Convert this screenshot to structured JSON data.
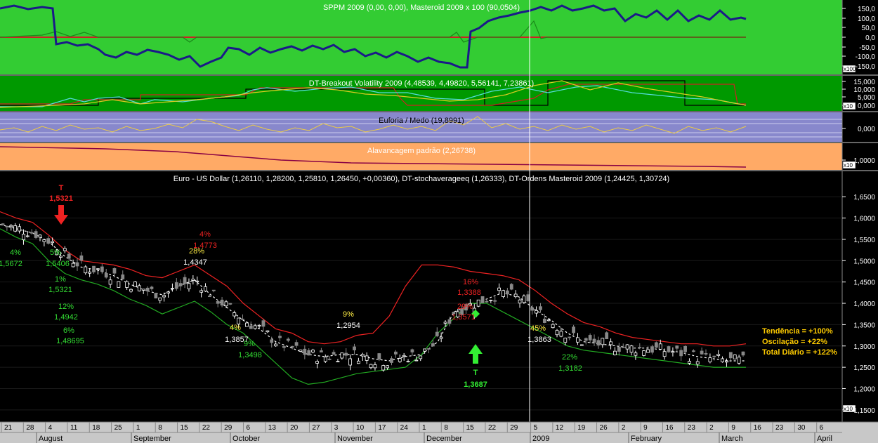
{
  "panels": {
    "sppm": {
      "title": "SPPM 2009 (0,00, 0,00), Masteroid 2009 x 100 (90,0504)",
      "tick_labels": [
        "150,0",
        "100,0",
        "50,0",
        "0,0",
        "-50,0",
        "-100,0",
        "-150,0"
      ],
      "multiplier": "x100",
      "bg": "#33cc33"
    },
    "dt_breakout": {
      "title": "DT-Breakout Volatility 2009 (4,48539, 4,49820, 5,56141, 7,23861)",
      "tick_labels": [
        "15,000",
        "10,000",
        "5,000",
        "0,000"
      ],
      "multiplier": "x10",
      "bg": "#009900"
    },
    "euforia": {
      "title": "Euforia / Medo (19,8991)",
      "tick_labels": [
        "0,000"
      ],
      "bg": "#8888cc"
    },
    "alavancagem": {
      "title": "Alavancagem padrão (2,26738)",
      "tick_labels": [
        "1,0000"
      ],
      "multiplier": "x10",
      "bg": "#ffaa66"
    },
    "price": {
      "title": "Euro - US Dollar (1,26110, 1,28200, 1,25810, 1,26450, +0,00360), DT-stochaverageeq (1,26333), DT-Ordens Masteroid 2009 (1,24425, 1,30724)",
      "tick_labels": [
        "1,6500",
        "1,6000",
        "1,5500",
        "1,5000",
        "1,4500",
        "1,4000",
        "1,3500",
        "1,3000",
        "1,2500",
        "1,2000",
        "1,1500"
      ],
      "multiplier": "x10",
      "bg": "#000000"
    }
  },
  "annotations": {
    "t_sell": {
      "letter": "T",
      "price": "1,5321"
    },
    "t_buy": {
      "letter": "T",
      "price": "1,3687"
    },
    "labels": [
      {
        "text": "4%",
        "color": "#33dd33"
      },
      {
        "text": "1,5672",
        "color": "#33dd33"
      },
      {
        "text": "5%",
        "color": "#33dd33"
      },
      {
        "text": "1,5406",
        "color": "#33dd33"
      },
      {
        "text": "1%",
        "color": "#33dd33"
      },
      {
        "text": "1,5321",
        "color": "#33dd33"
      },
      {
        "text": "12%",
        "color": "#33dd33"
      },
      {
        "text": "1,4942",
        "color": "#33dd33"
      },
      {
        "text": "6%",
        "color": "#33dd33"
      },
      {
        "text": "1,48695",
        "color": "#33dd33"
      },
      {
        "text": "4%",
        "color": "#ee2222"
      },
      {
        "text": "1,4773",
        "color": "#ee2222"
      },
      {
        "text": "28%",
        "color": "#ffee44"
      },
      {
        "text": "1,4347",
        "color": "#ffffff"
      },
      {
        "text": "4%",
        "color": "#ffee44"
      },
      {
        "text": "1,3857",
        "color": "#ffffff"
      },
      {
        "text": "9%",
        "color": "#33dd33"
      },
      {
        "text": "1,3498",
        "color": "#33dd33"
      },
      {
        "text": "9%",
        "color": "#ffee44"
      },
      {
        "text": "1,2954",
        "color": "#ffffff"
      },
      {
        "text": "16%",
        "color": "#ee2222"
      },
      {
        "text": "1,3388",
        "color": "#ee2222"
      },
      {
        "text": "29%",
        "color": "#ee2222"
      },
      {
        "text": "1,3571",
        "color": "#ee2222"
      },
      {
        "text": "45%",
        "color": "#ffee44"
      },
      {
        "text": "1,3863",
        "color": "#ffffff"
      },
      {
        "text": "22%",
        "color": "#33dd33"
      },
      {
        "text": "1,3182",
        "color": "#33dd33"
      }
    ],
    "stats": [
      "Tendência = +100%",
      "Oscilação = +22%",
      "Total Diário = +122%"
    ],
    "stats_color": "#ffcc00"
  },
  "x_axis": {
    "day_ticks": [
      "21",
      "28",
      "4",
      "11",
      "18",
      "25",
      "1",
      "8",
      "15",
      "22",
      "29",
      "6",
      "13",
      "20",
      "27",
      "3",
      "10",
      "17",
      "24",
      "1",
      "8",
      "15",
      "22",
      "29",
      "5",
      "12",
      "19",
      "26",
      "2",
      "9",
      "16",
      "23",
      "2",
      "9",
      "16",
      "23",
      "30",
      "6"
    ],
    "months": [
      "August",
      "September",
      "October",
      "November",
      "December",
      "2009",
      "February",
      "March",
      "April"
    ]
  },
  "chart_data": {
    "type": "candlestick",
    "title": "Euro - US Dollar (1,26110, 1,28200, 1,25810, 1,26450, +0,00360)",
    "ylim": [
      1.13,
      1.68
    ],
    "x_range": [
      "2008-07-21",
      "2009-04-06"
    ],
    "series": [
      {
        "name": "DT-stochaverageeq",
        "color": "#ffffff",
        "values": [
          1.585,
          1.575,
          1.565,
          1.545,
          1.51,
          1.485,
          1.478,
          1.465,
          1.445,
          1.43,
          1.42,
          1.44,
          1.455,
          1.42,
          1.39,
          1.36,
          1.34,
          1.31,
          1.295,
          1.28,
          1.275,
          1.28,
          1.28,
          1.27,
          1.265,
          1.275,
          1.28,
          1.31,
          1.38,
          1.395,
          1.41,
          1.425,
          1.415,
          1.385,
          1.36,
          1.33,
          1.31,
          1.305,
          1.3,
          1.295,
          1.295,
          1.29,
          1.285,
          1.275,
          1.27,
          1.265,
          1.265
        ]
      },
      {
        "name": "Upper band",
        "color": "#ee2222",
        "values": [
          1.615,
          1.6,
          1.59,
          1.56,
          1.525,
          1.5,
          1.495,
          1.49,
          1.48,
          1.465,
          1.46,
          1.475,
          1.49,
          1.465,
          1.44,
          1.4,
          1.37,
          1.34,
          1.33,
          1.31,
          1.305,
          1.31,
          1.325,
          1.33,
          1.37,
          1.44,
          1.49,
          1.49,
          1.485,
          1.475,
          1.47,
          1.465,
          1.455,
          1.43,
          1.4,
          1.375,
          1.355,
          1.345,
          1.33,
          1.32,
          1.315,
          1.31,
          1.305,
          1.305,
          1.3,
          1.3,
          1.305
        ]
      },
      {
        "name": "Lower band",
        "color": "#22aa22",
        "values": [
          1.575,
          1.555,
          1.54,
          1.5,
          1.47,
          1.455,
          1.445,
          1.43,
          1.41,
          1.395,
          1.375,
          1.39,
          1.405,
          1.38,
          1.35,
          1.33,
          1.295,
          1.26,
          1.225,
          1.21,
          1.215,
          1.225,
          1.235,
          1.24,
          1.245,
          1.25,
          1.28,
          1.33,
          1.365,
          1.4,
          1.4,
          1.38,
          1.36,
          1.34,
          1.32,
          1.3,
          1.29,
          1.285,
          1.28,
          1.275,
          1.27,
          1.265,
          1.26,
          1.255,
          1.25,
          1.25,
          1.25
        ]
      }
    ]
  }
}
